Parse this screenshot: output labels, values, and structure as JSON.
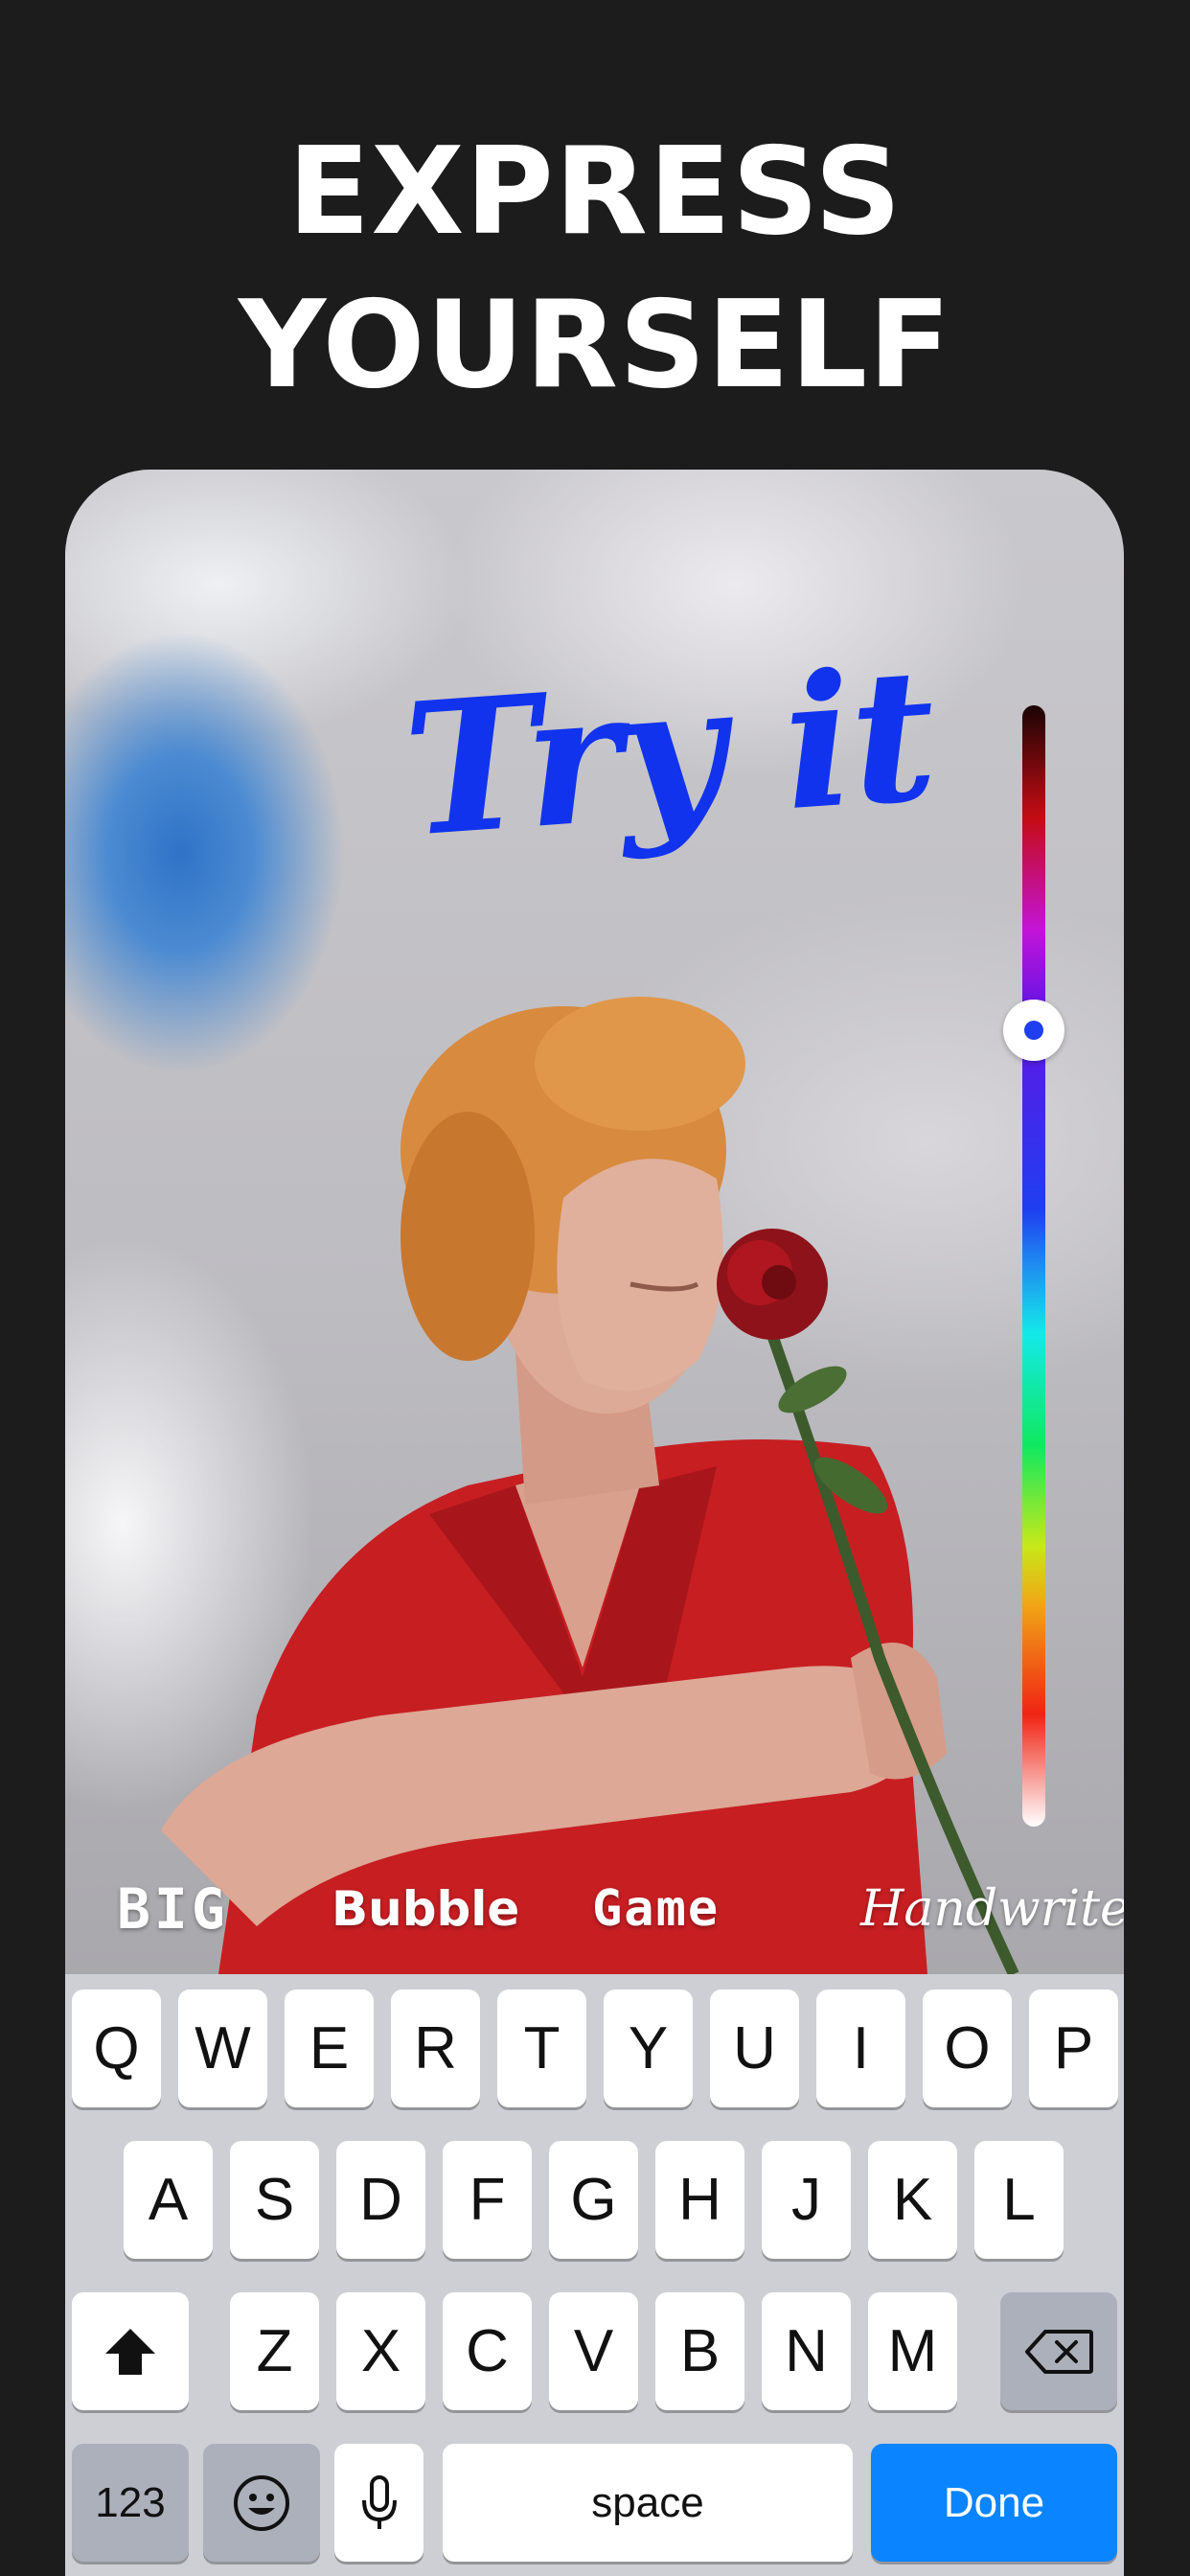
{
  "headline": {
    "line1": "EXPRESS",
    "line2": "YOURSELF"
  },
  "canvas": {
    "overlay_text": "Try it",
    "overlay_text_color": "#1133ee",
    "color_slider": {
      "selected_color": "#1f3ef0",
      "level": 0.29
    }
  },
  "font_styles": [
    "BIG",
    "Bubble",
    "Game",
    "Handwrite"
  ],
  "keyboard": {
    "row1": [
      "Q",
      "W",
      "E",
      "R",
      "T",
      "Y",
      "U",
      "I",
      "O",
      "P"
    ],
    "row2": [
      "A",
      "S",
      "D",
      "F",
      "G",
      "H",
      "J",
      "K",
      "L"
    ],
    "row3": [
      "Z",
      "X",
      "C",
      "V",
      "B",
      "N",
      "M"
    ],
    "numbers_key": "123",
    "space_key": "space",
    "done_key": "Done",
    "shift_icon": "shift-icon",
    "delete_icon": "backspace-icon",
    "emoji_icon": "emoji-icon",
    "mic_icon": "microphone-icon",
    "done_color": "#0b84ff"
  }
}
